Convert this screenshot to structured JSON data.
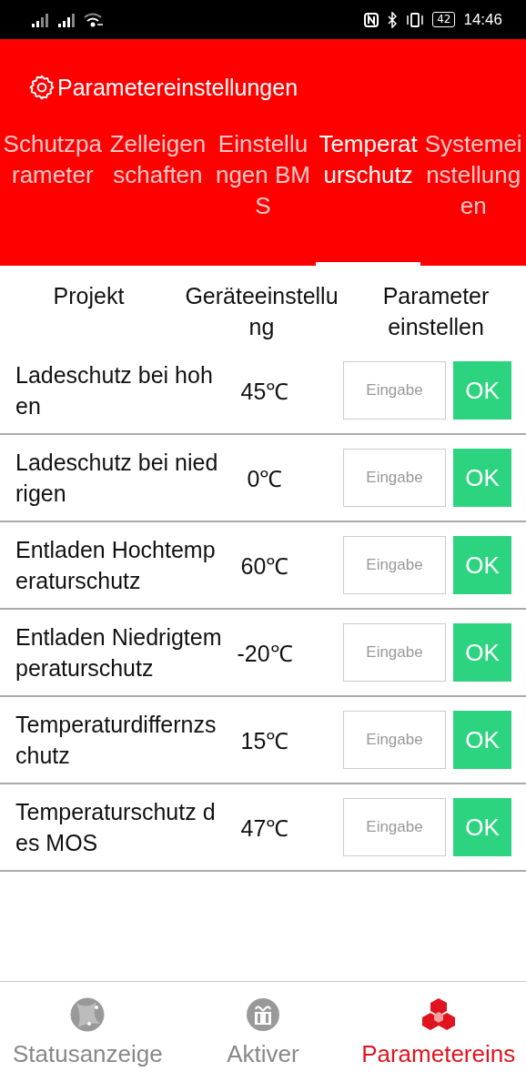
{
  "status_bar": {
    "time": "14:46",
    "battery": "42"
  },
  "header": {
    "title": "Parametereinstellungen"
  },
  "tabs": [
    {
      "label": "Schutzparameter",
      "selected": false
    },
    {
      "label": "Zelleigenschaften",
      "selected": false
    },
    {
      "label": "Einstellungen BMS",
      "selected": false
    },
    {
      "label": "Temperaturschutz",
      "selected": true
    },
    {
      "label": "Systemeinstellungen",
      "selected": false
    }
  ],
  "table": {
    "columns": [
      "Projekt",
      "Geräteeinstellung",
      "Parameter einstellen"
    ],
    "rows": [
      {
        "name": "Ladeschutz bei hohen",
        "value": "45℃",
        "placeholder": "Eingabe",
        "button": "OK"
      },
      {
        "name": "Ladeschutz bei niedrigen",
        "value": "0℃",
        "placeholder": "Eingabe",
        "button": "OK"
      },
      {
        "name": "Entladen Hochtemperaturschutz",
        "value": "60℃",
        "placeholder": "Eingabe",
        "button": "OK"
      },
      {
        "name": "Entladen Niedrigtemperaturschutz",
        "value": "-20℃",
        "placeholder": "Eingabe",
        "button": "OK"
      },
      {
        "name": "Temperaturdiffernzschutz",
        "value": "15℃",
        "placeholder": "Eingabe",
        "button": "OK"
      },
      {
        "name": "Temperaturschutz des MOS",
        "value": "47℃",
        "placeholder": "Eingabe",
        "button": "OK"
      }
    ]
  },
  "bottom_nav": [
    {
      "label": "Statusanzeige",
      "selected": false
    },
    {
      "label": "Aktiver",
      "selected": false
    },
    {
      "label": "Parametereins",
      "selected": true
    }
  ]
}
